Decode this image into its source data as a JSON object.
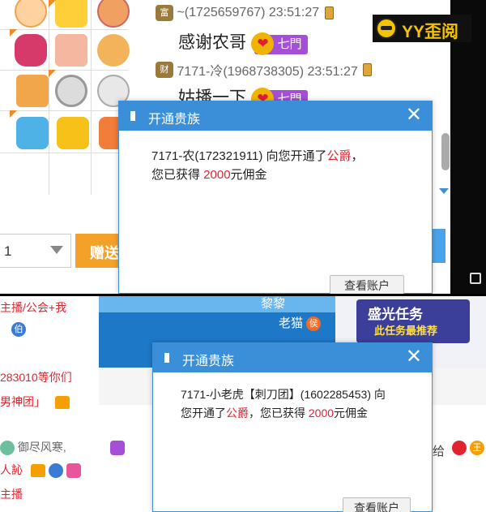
{
  "top": {
    "chat": [
      {
        "badge": "富",
        "uid": "~(1725659767) 23:51:27",
        "message": "感谢农哥",
        "level": "七門"
      },
      {
        "badge": "财",
        "uid": "7171-冷(1968738305) 23:51:27",
        "message": "姑播一下",
        "level": "七門"
      }
    ],
    "quantity": "1",
    "gift_button": "赠送",
    "logo_text": "YY歪阅",
    "dialog": {
      "title": "开通贵族",
      "line1_pre": "7171-农(172321911) 向您开通了",
      "line1_rank": "公爵",
      "line1_post": "，",
      "line2_pre": "您已获得 ",
      "line2_amount": "2000",
      "line2_post": "元佣金",
      "view_button": "查看账户"
    }
  },
  "bottom": {
    "left_lines": [
      "主播/公会+我",
      "伯",
      "283010等你们",
      "男神团」",
      "御尽风寒,",
      "人訫",
      "主播"
    ],
    "banner_names": [
      "黎黎",
      "老猫"
    ],
    "vip_tag": "侯",
    "promo_title": "盛光任务",
    "promo_sub": "此任务最推荐",
    "dialog": {
      "title": "开通贵族",
      "line1": "7171-小老虎【刺刀团】(1602285453) 向",
      "line2_pre": "您开通了",
      "line2_rank": "公爵",
      "line2_mid": "，您已获得 ",
      "line2_amount": "2000",
      "line2_post": "元佣金",
      "view_button": "查看账户"
    },
    "right_text": "给",
    "right_badge": "王"
  }
}
